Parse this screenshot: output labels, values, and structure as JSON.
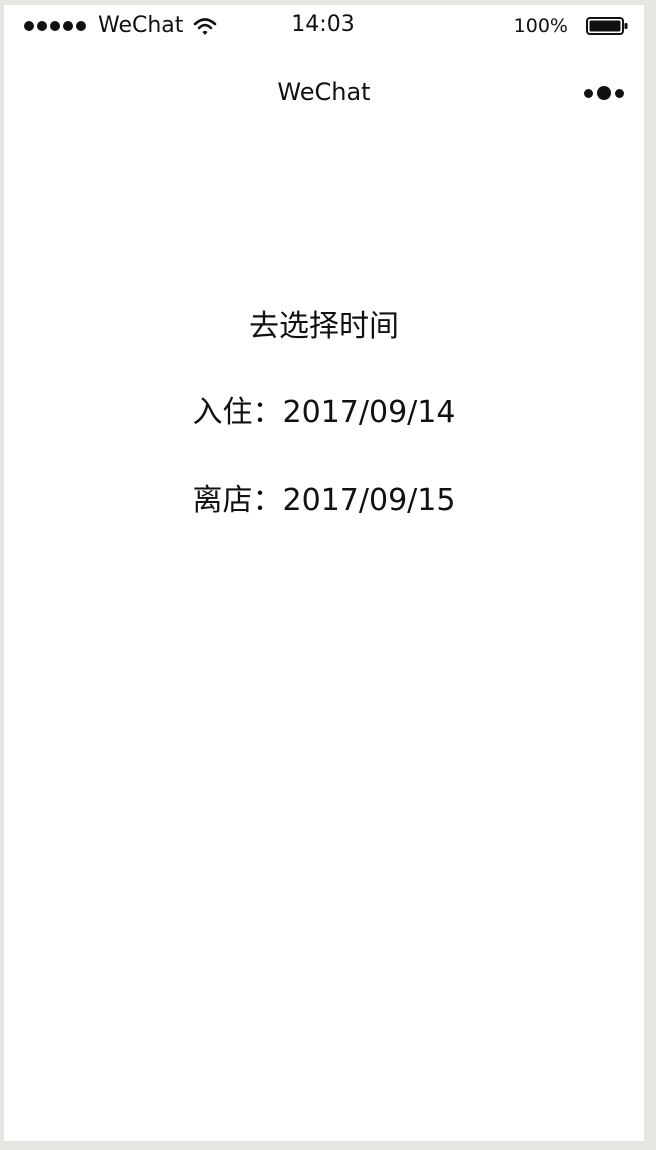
{
  "status_bar": {
    "carrier": "WeChat",
    "time": "14:03",
    "battery_percent": "100%",
    "signal_icon": "signal-dots-icon",
    "wifi_icon": "wifi-icon",
    "battery_icon": "battery-icon"
  },
  "nav": {
    "title": "WeChat",
    "more_icon": "more-dots-icon"
  },
  "content": {
    "select_time_label": "去选择时间",
    "checkin_label": "入住：",
    "checkin_date": "2017/09/14",
    "checkout_label": "离店：",
    "checkout_date": "2017/09/15"
  }
}
